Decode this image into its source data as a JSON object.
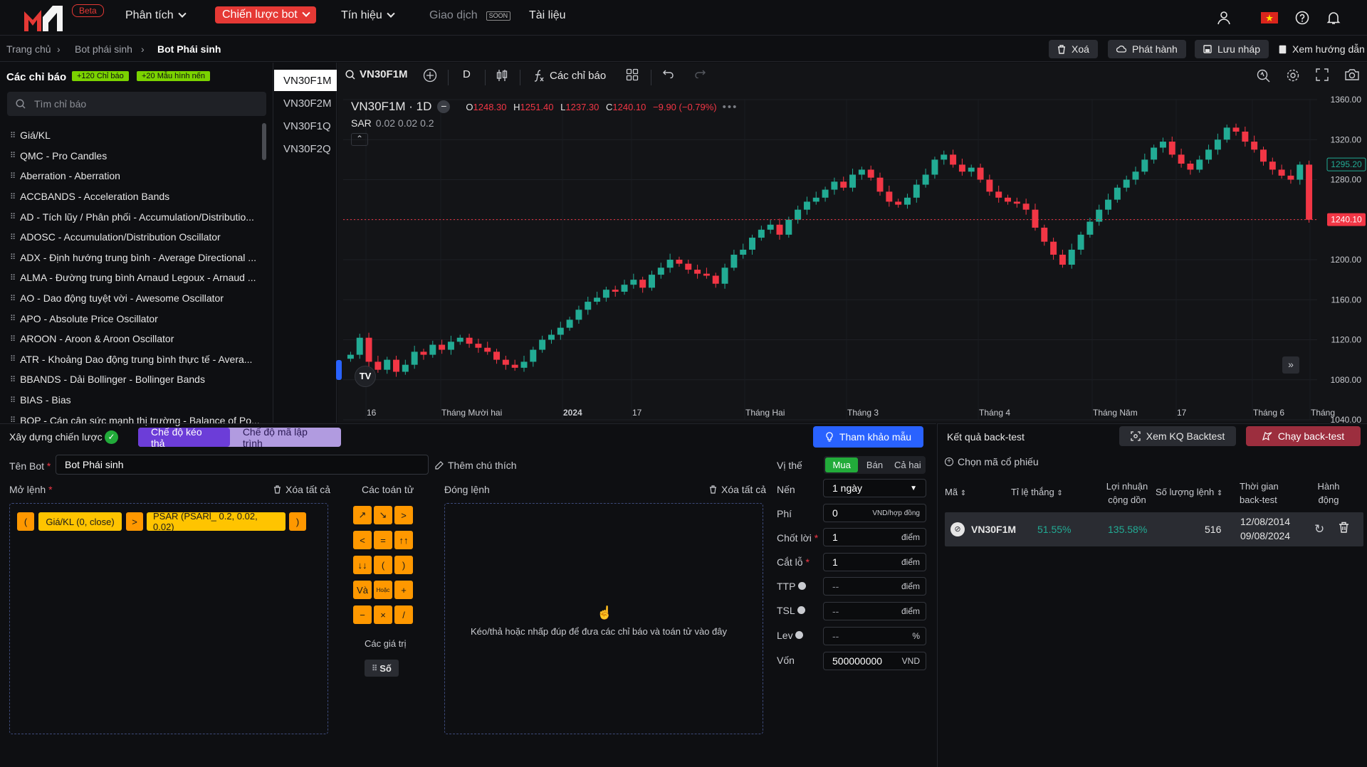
{
  "brand": {
    "beta": "Beta"
  },
  "nav": {
    "items": [
      {
        "label": "Phân tích"
      },
      {
        "label": "Chiến lược bot"
      },
      {
        "label": "Tín hiệu"
      },
      {
        "label": "Giao dịch",
        "badge": "SOON"
      },
      {
        "label": "Tài liệu"
      }
    ]
  },
  "breadcrumb": {
    "items": [
      "Trang chủ",
      "Bot phái sinh",
      "Bot Phái sinh"
    ]
  },
  "actions": {
    "delete": "Xoá",
    "publish": "Phát hành",
    "save_draft": "Lưu nháp",
    "guide": "Xem hướng dẫn"
  },
  "indicators_panel": {
    "title": "Các chỉ báo",
    "tag1": "+120 Chỉ báo",
    "tag2": "+20 Mẫu hình nến",
    "search_placeholder": "Tìm chỉ báo",
    "items": [
      "Giá/KL",
      "QMC - Pro Candles",
      "Aberration - Aberration",
      "ACCBANDS - Acceleration Bands",
      "AD - Tích lũy / Phân phối - Accumulation/Distributio...",
      "ADOSC - Accumulation/Distribution Oscillator",
      "ADX - Định hướng trung bình - Average Directional ...",
      "ALMA - Đường trung bình Arnaud Legoux - Arnaud ...",
      "AO - Dao động tuyệt vời - Awesome Oscillator",
      "APO - Absolute Price Oscillator",
      "AROON - Aroon & Aroon Oscillator",
      "ATR - Khoảng Dao động trung bình thực tế - Avera...",
      "BBANDS - Dải Bollinger - Bollinger Bands",
      "BIAS - Bias",
      "BOP - Cán cân sức mạnh thị trường - Balance of Po..."
    ]
  },
  "symbols": [
    "VN30F1M",
    "VN30F2M",
    "VN30F1Q",
    "VN30F2Q"
  ],
  "chart_toolbar": {
    "symbol": "VN30F1M",
    "interval": "D",
    "indicators": "Các chỉ báo"
  },
  "chart_legend": {
    "title": "VN30F1M · 1D",
    "o_label": "O",
    "o": "1248.30",
    "h_label": "H",
    "h": "1251.40",
    "l_label": "L",
    "l": "1237.30",
    "c_label": "C",
    "c": "1240.10",
    "change": "−9.90 (−0.79%)",
    "sar": "SAR",
    "sar_params": "0.02 0.02 0.2"
  },
  "chart_data": {
    "type": "candlestick",
    "yticks": [
      "1360.00",
      "1320.00",
      "1280.00",
      "1240.00",
      "1200.00",
      "1160.00",
      "1120.00",
      "1080.00",
      "1040.00"
    ],
    "ylim": [
      1040,
      1360
    ],
    "xticks": [
      "16",
      "Tháng Mười hai",
      "2024",
      "17",
      "Tháng Hai",
      "Tháng 3",
      "Tháng 4",
      "Tháng Năm",
      "17",
      "Tháng 6",
      "Tháng"
    ],
    "last_price": "1240.10",
    "sar_price": "1295.20",
    "close_series": [
      1105,
      1122,
      1098,
      1090,
      1100,
      1088,
      1095,
      1108,
      1105,
      1115,
      1110,
      1118,
      1122,
      1116,
      1112,
      1108,
      1100,
      1095,
      1092,
      1098,
      1110,
      1120,
      1125,
      1132,
      1140,
      1150,
      1158,
      1162,
      1170,
      1168,
      1175,
      1180,
      1172,
      1185,
      1192,
      1200,
      1196,
      1190,
      1186,
      1184,
      1176,
      1192,
      1205,
      1210,
      1222,
      1230,
      1235,
      1225,
      1240,
      1250,
      1258,
      1262,
      1270,
      1278,
      1272,
      1285,
      1290,
      1282,
      1268,
      1258,
      1255,
      1262,
      1275,
      1285,
      1300,
      1305,
      1295,
      1288,
      1292,
      1280,
      1268,
      1262,
      1258,
      1256,
      1250,
      1232,
      1218,
      1205,
      1195,
      1210,
      1225,
      1238,
      1250,
      1260,
      1272,
      1280,
      1288,
      1300,
      1312,
      1318,
      1305,
      1296,
      1290,
      1300,
      1310,
      1320,
      1332,
      1328,
      1318,
      1310,
      1298,
      1290,
      1284,
      1280,
      1295,
      1240
    ]
  },
  "builder": {
    "title": "Xây dựng chiến lược",
    "mode_drag": "Chế độ kéo thả",
    "mode_code": "Chế độ mã lập trình",
    "template_btn": "Tham khảo mẫu",
    "bot_name_label": "Tên Bot",
    "bot_name": "Bot Phái sinh",
    "add_note": "Thêm chú thích",
    "open_label": "Mở lệnh",
    "clear_all": "Xóa tất cả",
    "close_label": "Đóng lệnh",
    "operators_title": "Các toán tử",
    "values_title": "Các giá trị",
    "value_number": "Số",
    "open_tokens": [
      "(",
      "Giá/KL (0, close)",
      ">",
      "PSAR (PSARl_ 0.2, 0.02, 0.02)",
      ")"
    ],
    "operators": [
      "↗",
      "↘",
      ">",
      "<",
      "=",
      "↑↑",
      "↓↓",
      "(",
      ")",
      "Và",
      "Hoặc",
      "+",
      "−",
      "×",
      "/"
    ],
    "drop_hint": "Kéo/thả hoặc nhấp đúp để đưa các chỉ báo và toán tử vào đây"
  },
  "settings": {
    "position_label": "Vị thế",
    "position_options": [
      "Mua",
      "Bán",
      "Cả hai"
    ],
    "candle_label": "Nến",
    "candle_value": "1 ngày",
    "fee_label": "Phí",
    "fee_value": "0",
    "fee_unit": "VND/hợp đồng",
    "tp_label": "Chốt lời",
    "tp_value": "1",
    "sl_label": "Cắt lỗ",
    "sl_value": "1",
    "ttp_label": "TTP",
    "tsl_label": "TSL",
    "lev_label": "Lev",
    "placeholder": "--",
    "point_unit": "điểm",
    "percent_unit": "%",
    "capital_label": "Vốn",
    "capital_value": "500000000",
    "capital_unit": "VND"
  },
  "results": {
    "title": "Kết quả back-test",
    "view_btn": "Xem KQ Backtest",
    "run_btn": "Chạy back-test",
    "choose": "Chọn mã cổ phiếu",
    "headers": [
      "Mã",
      "Tỉ lệ thắng",
      "Lợi nhuận cộng dồn",
      "Số lượng lệnh",
      "Thời gian back-test",
      "Hành động"
    ],
    "row": {
      "symbol": "VN30F1M",
      "win_rate": "51.55%",
      "profit": "135.58%",
      "orders": "516",
      "from": "12/08/2014",
      "to": "09/08/2024"
    }
  }
}
